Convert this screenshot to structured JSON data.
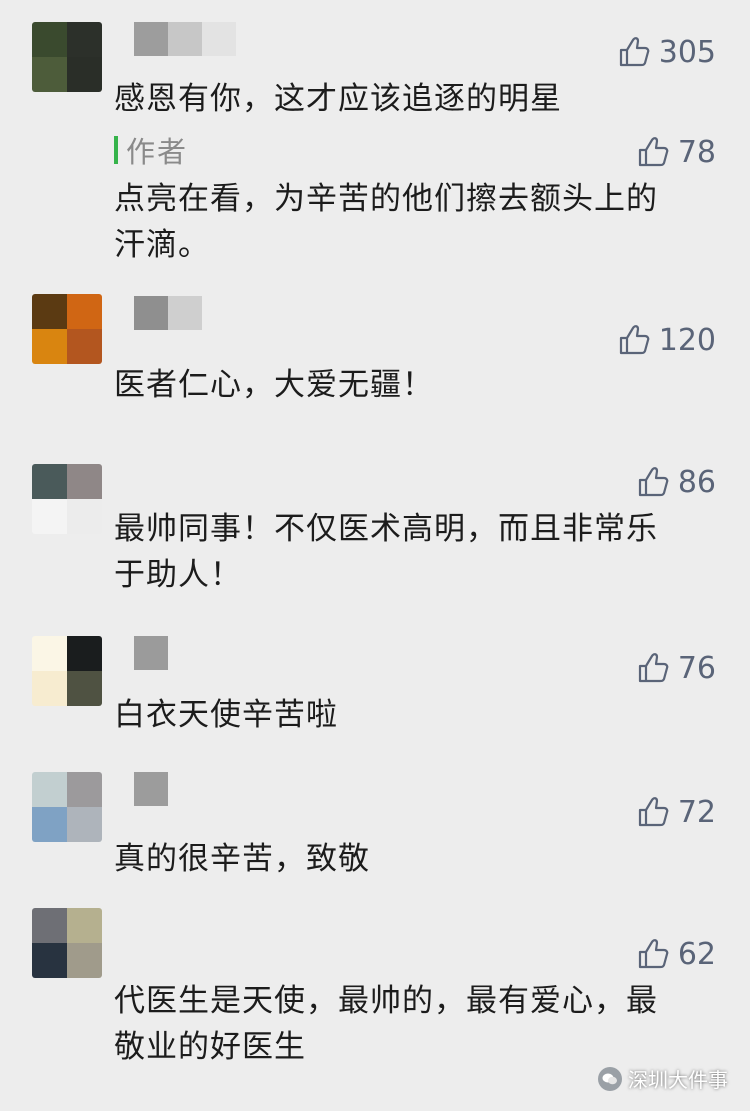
{
  "comments": [
    {
      "text": "感恩有你，这才应该追逐的明星",
      "likes": "305",
      "avatar_colors": [
        "#3a4a2e",
        "#2c302a",
        "#4d5c3a",
        "#2a2e28"
      ],
      "nick_colors": [
        "#9d9d9d",
        "#c7c7c7",
        "#e3e3e3"
      ],
      "reply": {
        "author_label": "作者",
        "likes": "78",
        "lines": [
          "点亮在看，为辛苦的他们擦去额头上的",
          "汗滴。"
        ]
      }
    },
    {
      "text": "医者仁心，大爱无疆！",
      "likes": "120",
      "avatar_colors": [
        "#5b3a12",
        "#d06614",
        "#d98510",
        "#b3561f"
      ],
      "nick_colors": [
        "#8f8f8f",
        "#cfcfcf"
      ]
    },
    {
      "lines": [
        "最帅同事！不仅医术高明，而且非常乐",
        "于助人！"
      ],
      "likes": "86",
      "avatar_colors": [
        "#4a5a5a",
        "#8f8787",
        "#f4f4f4",
        "#ececec"
      ],
      "nick_colors": []
    },
    {
      "text": "白衣天使辛苦啦",
      "likes": "76",
      "avatar_colors": [
        "#fbf6e6",
        "#1a1d1e",
        "#f7ecd0",
        "#4f5242"
      ],
      "nick_colors": [
        "#9b9b9b"
      ]
    },
    {
      "text": "真的很辛苦，致敬",
      "likes": "72",
      "avatar_colors": [
        "#c2cfd0",
        "#9c9a9c",
        "#7fa2c4",
        "#aeb4bb"
      ],
      "nick_colors": [
        "#9c9c9c"
      ]
    },
    {
      "lines": [
        "代医生是天使，最帅的，最有爱心，最",
        "敬业的好医生"
      ],
      "likes": "62",
      "avatar_colors": [
        "#6e6f75",
        "#b5b08f",
        "#283340",
        "#a09b8b"
      ],
      "nick_colors": []
    }
  ],
  "watermark": {
    "icon": "wechat-icon",
    "text": "深圳大件事"
  },
  "colors": {
    "background": "#ededed",
    "like": "#5a6478",
    "author_accent": "#35b34a"
  }
}
